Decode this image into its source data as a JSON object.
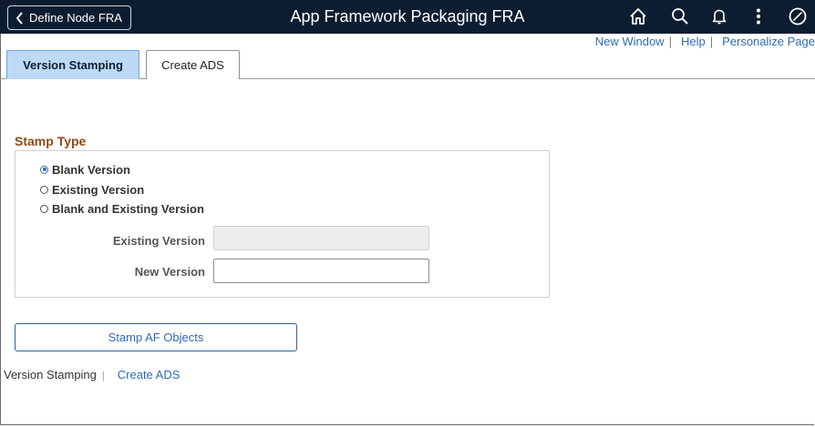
{
  "header": {
    "back_label": "Define Node FRA",
    "title": "App Framework Packaging FRA",
    "icons": [
      "home-icon",
      "search-icon",
      "bell-icon",
      "more-vertical-icon",
      "navbar-compass-icon"
    ]
  },
  "top_links": {
    "new_window": "New Window",
    "help": "Help",
    "personalize": "Personalize Page",
    "separator": "|"
  },
  "tabs": [
    {
      "label": "Version Stamping",
      "active": true
    },
    {
      "label": "Create ADS",
      "active": false
    }
  ],
  "stamp_type": {
    "title": "Stamp Type",
    "options": [
      {
        "label": "Blank Version",
        "selected": true
      },
      {
        "label": "Existing Version",
        "selected": false
      },
      {
        "label": "Blank and Existing Version",
        "selected": false
      }
    ],
    "existing_version": {
      "label": "Existing Version",
      "value": "",
      "disabled": true
    },
    "new_version": {
      "label": "New Version",
      "value": ""
    }
  },
  "stamp_button": "Stamp AF Objects",
  "bottom_links": {
    "current": "Version Stamping",
    "separator": "|",
    "other": "Create ADS"
  },
  "colors": {
    "header_bg": "#0d1d31",
    "link": "#2f6bb3",
    "group_title": "#8c4a14",
    "active_tab": "#bcdaf5"
  }
}
